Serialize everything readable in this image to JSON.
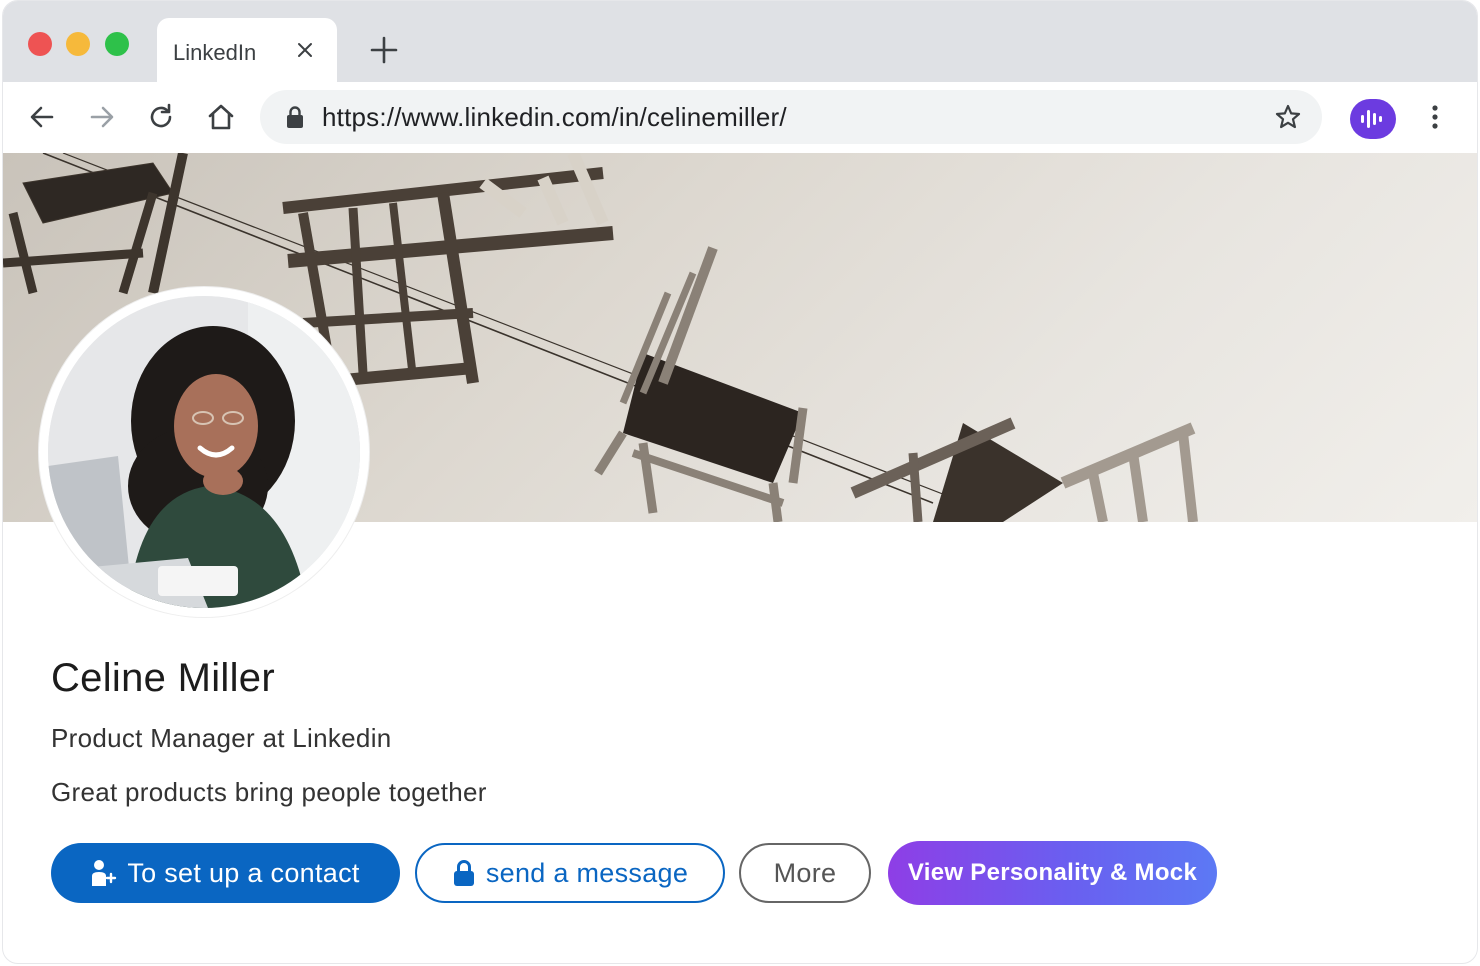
{
  "browser": {
    "tab_title": "LinkedIn",
    "url": "https://www.linkedin.com/in/celinemiller/"
  },
  "profile": {
    "name": "Celine Miller",
    "headline": "Product Manager at Linkedin",
    "tagline": "Great products bring people together"
  },
  "actions": {
    "connect_label": "To set up a contact",
    "message_label": "send a message",
    "more_label": "More",
    "personality_label": "View Personality & Mock"
  },
  "colors": {
    "linkedin_blue": "#0a66c2",
    "extension_purple": "#6c3be0"
  },
  "icons": {
    "back": "arrow-left-icon",
    "forward": "arrow-right-icon",
    "reload": "reload-icon",
    "home": "home-icon",
    "lock": "lock-icon",
    "bookmark": "star-icon",
    "extension": "voice-wave-icon",
    "menu": "kebab-menu-icon"
  }
}
